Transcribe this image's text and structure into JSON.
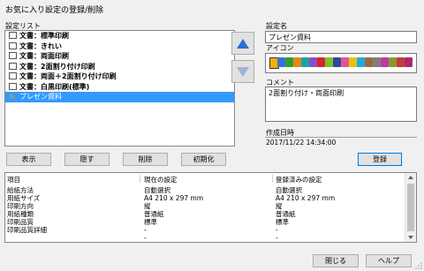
{
  "window": {
    "title": "お気に入り設定の登録/削除"
  },
  "settings_list": {
    "label": "設定リスト",
    "items": [
      {
        "label": "文書：標準印刷",
        "selected": false
      },
      {
        "label": "文書：きれい",
        "selected": false
      },
      {
        "label": "文書：両面印刷",
        "selected": false
      },
      {
        "label": "文書：2面割り付け印刷",
        "selected": false
      },
      {
        "label": "文書：両面＋2面割り付け印刷",
        "selected": false
      },
      {
        "label": "文書：白黒印刷(標準)",
        "selected": false
      },
      {
        "label": "プレゼン資料",
        "selected": true
      }
    ]
  },
  "right_panel": {
    "name_label": "設定名",
    "name_value": "プレゼン資料",
    "icon_label": "アイコン",
    "icons": [
      {
        "name": "pencil-icon",
        "color": "#f0b000"
      },
      {
        "name": "doc-icon-blue",
        "color": "#3a6fd8"
      },
      {
        "name": "doc-icon-green",
        "color": "#2ca02c"
      },
      {
        "name": "doc-icon-orange",
        "color": "#e08a1e"
      },
      {
        "name": "doc-icon-teal",
        "color": "#1aa3a3"
      },
      {
        "name": "doc-icon-purple",
        "color": "#8a4fc7"
      },
      {
        "name": "doc-icon-red",
        "color": "#d62728"
      },
      {
        "name": "doc-icon-lime",
        "color": "#7fbf2a"
      },
      {
        "name": "doc-icon-navy",
        "color": "#2b4a9c"
      },
      {
        "name": "doc-icon-pink",
        "color": "#e0559a"
      },
      {
        "name": "doc-icon-yellow",
        "color": "#e6c400"
      },
      {
        "name": "doc-icon-cyan",
        "color": "#22a9e0"
      },
      {
        "name": "doc-icon-brown",
        "color": "#9c6a3a"
      },
      {
        "name": "doc-icon-gray",
        "color": "#7f7f7f"
      },
      {
        "name": "doc-icon-magenta",
        "color": "#c0399e"
      },
      {
        "name": "doc-icon-olive",
        "color": "#8a9a2a"
      },
      {
        "name": "doc-icon-crimson",
        "color": "#c23b3b"
      },
      {
        "name": "doc-icon-violet",
        "color": "#b0276b"
      }
    ],
    "comment_label": "コメント",
    "comment_value": "2面割り付け・両面印刷",
    "created_label": "作成日時",
    "created_value": "2017/11/22 14:34:00",
    "register_button": "登録"
  },
  "actions": {
    "display": "表示",
    "hide": "隠す",
    "delete": "削除",
    "initialize": "初期化"
  },
  "table": {
    "headers": [
      "項目",
      "現在の設定",
      "登録済みの設定"
    ],
    "rows": [
      [
        "給紙方法",
        "自動選択",
        "自動選択"
      ],
      [
        "用紙サイズ",
        "A4 210 x 297 mm",
        "A4 210 x 297 mm"
      ],
      [
        "印刷方向",
        "縦",
        "縦"
      ],
      [
        "用紙種類",
        "普通紙",
        "普通紙"
      ],
      [
        "印刷品質",
        "標準",
        "標準"
      ],
      [
        "印刷品質詳細",
        "-",
        "-"
      ],
      [
        "",
        "-",
        "-"
      ]
    ]
  },
  "footer": {
    "close": "閉じる",
    "help": "ヘルプ"
  },
  "colors": {
    "selection": "#3399ff",
    "up_arrow": "#2a6fd6",
    "down_arrow": "#9cb4d9",
    "default_button_border": "#0078d7"
  }
}
